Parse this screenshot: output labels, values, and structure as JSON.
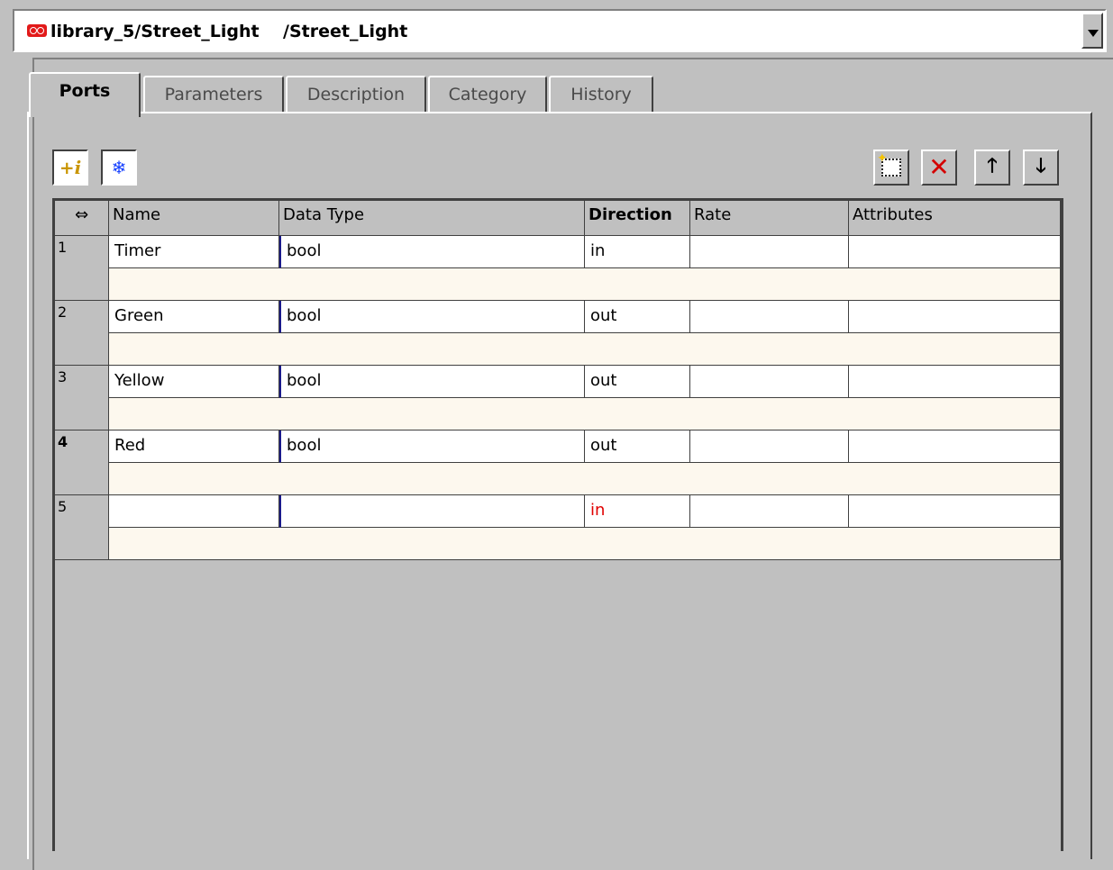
{
  "title_bar": {
    "path_label": "library_5/Street_Light    /Street_Light",
    "icon": "block-icon"
  },
  "tabs": [
    {
      "label": "Ports",
      "active": true
    },
    {
      "label": "Parameters",
      "active": false
    },
    {
      "label": "Description",
      "active": false
    },
    {
      "label": "Category",
      "active": false
    },
    {
      "label": "History",
      "active": false
    }
  ],
  "toolbar_left": [
    {
      "icon": "add-info-icon",
      "glyph": "+i"
    },
    {
      "icon": "freeze-icon",
      "glyph": "❄"
    }
  ],
  "toolbar_right": [
    {
      "icon": "new-row-icon"
    },
    {
      "icon": "delete-icon",
      "glyph": "✕"
    },
    {
      "icon": "arrow-up-icon",
      "glyph": "🡑"
    },
    {
      "icon": "arrow-down-icon",
      "glyph": "🡓"
    }
  ],
  "table": {
    "corner_glyph": "⇔",
    "columns": [
      "Name",
      "Data Type",
      "Direction",
      "Rate",
      "Attributes"
    ],
    "rows": [
      {
        "num": "1",
        "name": "Timer",
        "type": "bool",
        "direction": "in",
        "rate": "",
        "attributes": ""
      },
      {
        "num": "2",
        "name": "Green",
        "type": "bool",
        "direction": "out",
        "rate": "",
        "attributes": ""
      },
      {
        "num": "3",
        "name": "Yellow",
        "type": "bool",
        "direction": "out",
        "rate": "",
        "attributes": ""
      },
      {
        "num": "4",
        "name": "Red",
        "type": "bool",
        "direction": "out",
        "rate": "",
        "attributes": ""
      },
      {
        "num": "5",
        "name": "",
        "type": "",
        "direction": "in",
        "rate": "",
        "attributes": ""
      }
    ]
  },
  "colors": {
    "background": "#c0c0c0",
    "description_row": "#fdf8ee",
    "new_row_direction": "#e00000",
    "title_icon": "#e21a1a"
  }
}
